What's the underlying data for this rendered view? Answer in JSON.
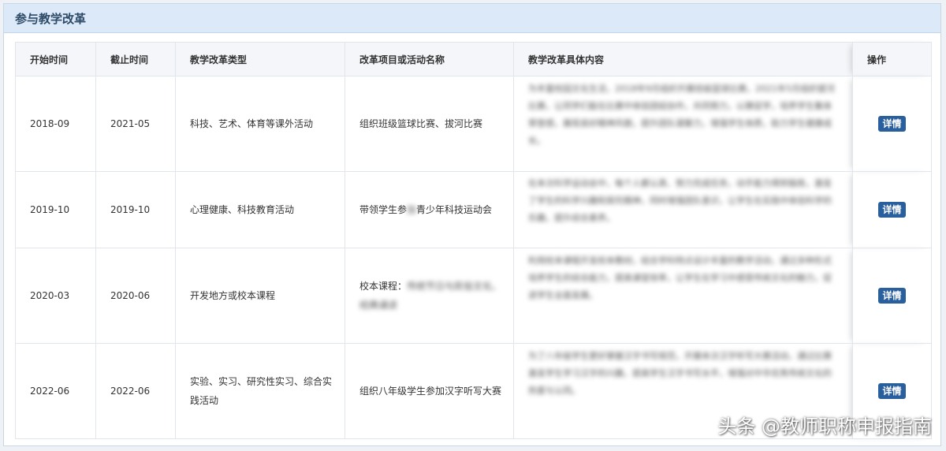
{
  "panel": {
    "title": "参与教学改革"
  },
  "table": {
    "headers": [
      "开始时间",
      "截止时间",
      "教学改革类型",
      "改革项目或活动名称",
      "教学改革具体内容",
      "操作"
    ],
    "rows": [
      {
        "start": "2018-09",
        "end": "2021-05",
        "type": "科技、艺术、体育等课外活动",
        "name": "组织班级篮球比赛、拔河比赛",
        "content": "为丰富校园文化生活，2018年9月组织开展班级篮球比赛，2021年5月组织拔河比赛，让同学们能在比赛中体验团结协作，共同努力，以赛促学，培养学生集体荣誉感，展现良好精神风貌，提升团队凝聚力，增强学生体质，助力学生健康成长。",
        "action": "详情"
      },
      {
        "start": "2019-10",
        "end": "2019-10",
        "type": "心理健康、科技教育活动",
        "name": "带领学生参加青少年科技运动会",
        "name_parts": [
          "带领学生参",
          "加",
          "青少年科技运动会"
        ],
        "content": "在本次科学运动会中，每个人都认真、努力完成任务，动手能力得到锻炼，激发了学生的科学兴趣和探究精神，同时增强团队意识，让学生在实践中体验科学的乐趣，提升综合素养。",
        "action": "详情"
      },
      {
        "start": "2020-03",
        "end": "2020-06",
        "type": "开发地方或校本课程",
        "name": "校本课程：",
        "name_blur": "传统节日与民俗文化、经典诵读",
        "content": "利用校本课程开发校本教材，结合学科特点设计丰富的教学活动，通过多种形式培养学生的综合能力，提高课堂效率，让学生在学习中感受传统文化的魅力，促进学生全面发展。",
        "action": "详情"
      },
      {
        "start": "2022-06",
        "end": "2022-06",
        "type": "实验、实习、研究性实习、综合实践活动",
        "name": "组织八年级学生参加汉字听写大赛",
        "content": "为了八年级学生更好掌握汉字书写规范，开展本次汉字听写大赛活动，通过比赛激发学生学习汉字的兴趣，提高学生汉字书写水平，增强对中华优秀传统文化的热爱与认同。",
        "action": "详情"
      }
    ]
  },
  "watermark": "头条 @教师职称申报指南"
}
